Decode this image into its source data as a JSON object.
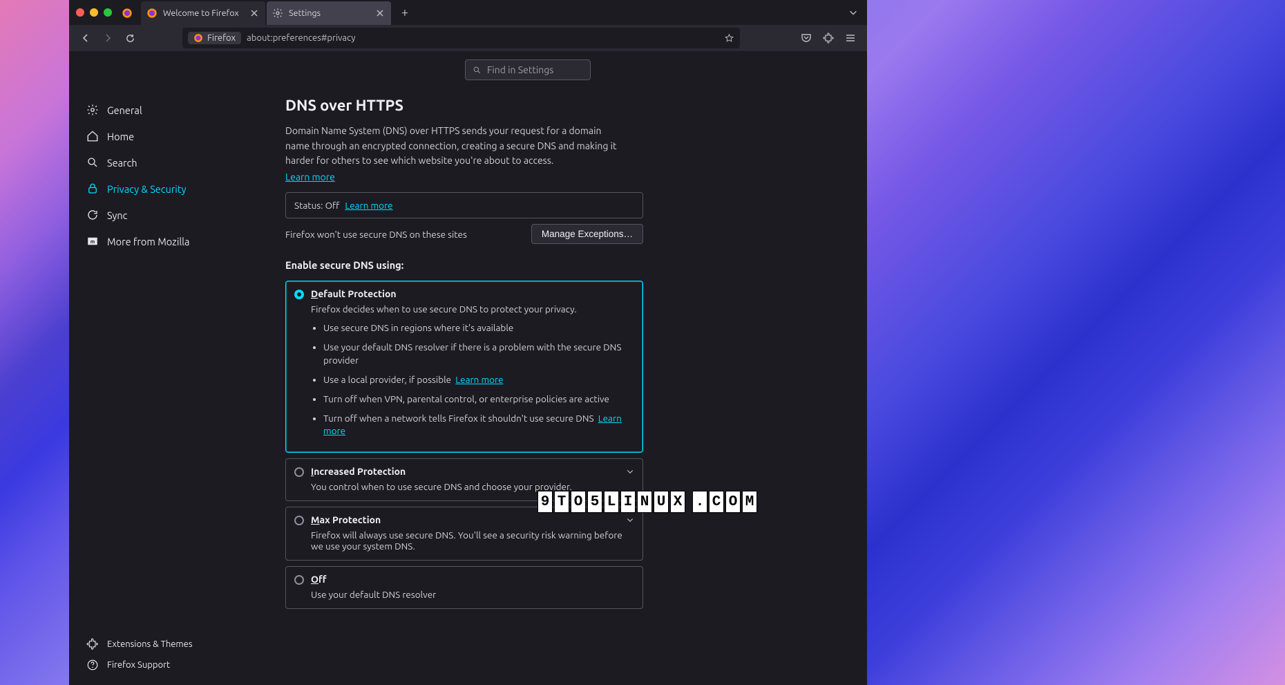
{
  "tabs": {
    "t0_title": "Welcome to Firefox",
    "t1_title": "Settings"
  },
  "urlbar": {
    "identity": "Firefox",
    "url": "about:preferences#privacy"
  },
  "find": {
    "placeholder": "Find in Settings"
  },
  "sidebar": {
    "general": "General",
    "home": "Home",
    "search": "Search",
    "privacy": "Privacy & Security",
    "sync": "Sync",
    "more": "More from Mozilla",
    "ext": "Extensions & Themes",
    "support": "Firefox Support"
  },
  "page": {
    "title": "DNS over HTTPS",
    "desc": "Domain Name System (DNS) over HTTPS sends your request for a domain name through an encrypted connection, creating a secure DNS and making it harder for others to see which website you're about to access.",
    "learn_more": "Learn more",
    "status": "Status: Off",
    "status_learn": "Learn more",
    "except_text": "Firefox won't use secure DNS on these sites",
    "except_btn": "Manage Exceptions…",
    "enable_heading": "Enable secure DNS using:",
    "opt_default_title": "Default Protection",
    "opt_default_desc": "Firefox decides when to use secure DNS to protect your privacy.",
    "opt_default_b1": "Use secure DNS in regions where it's available",
    "opt_default_b2": "Use your default DNS resolver if there is a problem with the secure DNS provider",
    "opt_default_b3": "Use a local provider, if possible",
    "opt_default_b3_link": "Learn more",
    "opt_default_b4": "Turn off when VPN, parental control, or enterprise policies are active",
    "opt_default_b5": "Turn off when a network tells Firefox it shouldn't use secure DNS",
    "opt_default_b5_link": "Learn more",
    "opt_increased_title": "Increased Protection",
    "opt_increased_desc": "You control when to use secure DNS and choose your provider.",
    "opt_max_title": "Max Protection",
    "opt_max_desc": "Firefox will always use secure DNS. You'll see a security risk warning before we use your system DNS.",
    "opt_off_title": "Off",
    "opt_off_desc": "Use your default DNS resolver"
  },
  "watermark": "9TO5LINUX.COM"
}
